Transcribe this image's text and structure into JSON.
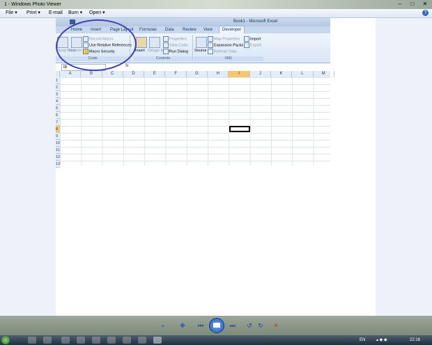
{
  "window": {
    "title": "1 - Windows Photo Viewer",
    "help_label": "?"
  },
  "menu": [
    {
      "label": "File",
      "arrow": "▾"
    },
    {
      "label": "Print",
      "arrow": "▾"
    },
    {
      "label": "E-mail",
      "arrow": ""
    },
    {
      "label": "Burn",
      "arrow": "▾"
    },
    {
      "label": "Open",
      "arrow": "▾"
    }
  ],
  "excel": {
    "title": "Book1 - Microsoft Excel",
    "tabs": [
      "Home",
      "Insert",
      "Page Layout",
      "Formulas",
      "Data",
      "Review",
      "View",
      "Developer"
    ],
    "active_tab": "Developer",
    "groups": {
      "code": {
        "label": "Code",
        "visual_basic": "Visual Basic",
        "macros": "Macros",
        "record_macro": "Record Macro",
        "use_relative": "Use Relative References",
        "macro_security": "Macro Security"
      },
      "controls": {
        "label": "Controls",
        "insert": "Insert",
        "design_mode": "Design Mode",
        "properties": "Properties",
        "view_code": "View Code",
        "run_dialog": "Run Dialog"
      },
      "xml": {
        "label": "XML",
        "source": "Source",
        "map_properties": "Map Properties",
        "expansion_packs": "Expansion Packs",
        "refresh_data": "Refresh Data",
        "import": "Import",
        "export": "Export"
      }
    },
    "name_box": "I8",
    "fx_label": "fx",
    "columns": [
      "A",
      "B",
      "C",
      "D",
      "E",
      "F",
      "G",
      "H",
      "I",
      "J",
      "K",
      "L",
      "M"
    ],
    "rows": [
      "1",
      "2",
      "3",
      "4",
      "5",
      "6",
      "7",
      "8",
      "9",
      "10",
      "11",
      "12",
      "13"
    ],
    "selected_column": "I",
    "selected_row": "8"
  },
  "tray": {
    "lang": "EN",
    "time": "22:16"
  },
  "colors": {
    "ribbon": "#dfe9f6",
    "annotation": "#3f3dbb",
    "selected_header": "#f7c56b"
  }
}
